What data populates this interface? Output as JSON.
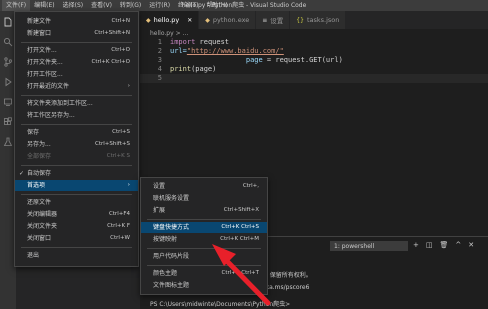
{
  "titlebar": {
    "menus": [
      "文件(F)",
      "编辑(E)",
      "选择(S)",
      "查看(V)",
      "转到(G)",
      "运行(R)",
      "终端(T)",
      "帮助(H)"
    ],
    "title": "hello.py - Python爬虫 - Visual Studio Code"
  },
  "tabs": [
    {
      "label": "hello.py",
      "icon": "python-file-icon",
      "active": true
    },
    {
      "label": "python.exe",
      "icon": "python-file-icon",
      "active": false
    },
    {
      "label": "设置",
      "icon": "settings-file-icon",
      "active": false
    },
    {
      "label": "tasks.json",
      "icon": "json-file-icon",
      "active": false
    }
  ],
  "breadcrumb": "hello.py > ...",
  "editor": {
    "lines": [
      {
        "n": "1",
        "kw": "import",
        "rest": " request"
      },
      {
        "n": "2",
        "a": "url=",
        "s": "\"http://www.baidu.com/\""
      },
      {
        "n": "3",
        "a": "                  page",
        "b": " = request.GET(url)"
      },
      {
        "n": "4",
        "f": "print",
        "b": "(page)"
      },
      {
        "n": "5",
        "a": ""
      }
    ]
  },
  "file_menu": {
    "items": [
      {
        "label": "新建文件",
        "shortcut": "Ctrl+N"
      },
      {
        "label": "新建窗口",
        "shortcut": "Ctrl+Shift+N"
      },
      {
        "label": "打开文件...",
        "shortcut": "Ctrl+O"
      },
      {
        "label": "打开文件夹...",
        "shortcut": "Ctrl+K Ctrl+O"
      },
      {
        "label": "打开工作区...",
        "shortcut": ""
      },
      {
        "label": "打开最近的文件",
        "shortcut": "›"
      },
      {
        "label": "将文件夹添加到工作区...",
        "shortcut": ""
      },
      {
        "label": "将工作区另存为...",
        "shortcut": ""
      },
      {
        "label": "保存",
        "shortcut": "Ctrl+S"
      },
      {
        "label": "另存为...",
        "shortcut": "Ctrl+Shift+S"
      },
      {
        "label": "全部保存",
        "shortcut": "Ctrl+K S"
      },
      {
        "label": "自动保存",
        "shortcut": "",
        "check": "✓"
      },
      {
        "label": "首选项",
        "shortcut": "›"
      },
      {
        "label": "还原文件",
        "shortcut": ""
      },
      {
        "label": "关闭编辑器",
        "shortcut": "Ctrl+F4"
      },
      {
        "label": "关闭文件夹",
        "shortcut": "Ctrl+K F"
      },
      {
        "label": "关闭窗口",
        "shortcut": "Ctrl+W"
      },
      {
        "label": "退出",
        "shortcut": ""
      }
    ]
  },
  "prefs_menu": {
    "items": [
      {
        "label": "设置",
        "shortcut": "Ctrl+,"
      },
      {
        "label": "联机服务设置",
        "shortcut": ""
      },
      {
        "label": "扩展",
        "shortcut": "Ctrl+Shift+X"
      },
      {
        "label": "键盘快捷方式",
        "shortcut": "Ctrl+K Ctrl+S"
      },
      {
        "label": "按键映射",
        "shortcut": "Ctrl+K Ctrl+M"
      },
      {
        "label": "用户代码片段",
        "shortcut": ""
      },
      {
        "label": "颜色主题",
        "shortcut": "Ctrl+K Ctrl+T"
      },
      {
        "label": "文件图标主题",
        "shortcut": ""
      }
    ]
  },
  "terminal": {
    "selector": "1: powershell",
    "line1": "n。保留所有权利。",
    "line2": "/aka.ms/pscore6",
    "prompt": "PS C:\\Users\\midwinte\\Documents\\Python爬虫>"
  },
  "colors": {
    "highlight": "#094771",
    "arrow": "#e8202a"
  }
}
